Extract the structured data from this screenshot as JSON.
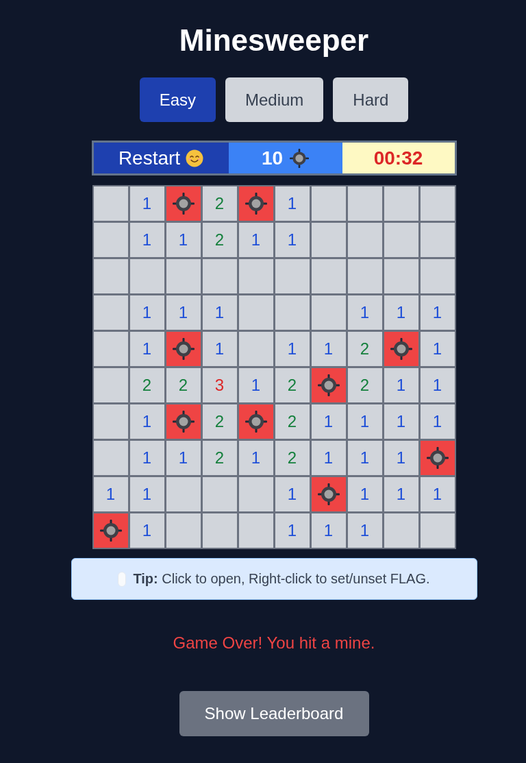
{
  "title": "Minesweeper",
  "difficulties": [
    {
      "label": "Easy",
      "selected": true
    },
    {
      "label": "Medium",
      "selected": false
    },
    {
      "label": "Hard",
      "selected": false
    }
  ],
  "status_bar": {
    "restart_label": "Restart",
    "mine_count": "10",
    "timer": "00:32"
  },
  "board": {
    "rows": [
      [
        {
          "kind": "empty"
        },
        {
          "kind": "number",
          "value": "1",
          "color": "#1d4ed8"
        },
        {
          "kind": "mine"
        },
        {
          "kind": "number",
          "value": "2",
          "color": "#15803d"
        },
        {
          "kind": "mine"
        },
        {
          "kind": "number",
          "value": "1",
          "color": "#1d4ed8"
        },
        {
          "kind": "empty"
        },
        {
          "kind": "empty"
        },
        {
          "kind": "empty"
        },
        {
          "kind": "empty"
        }
      ],
      [
        {
          "kind": "empty"
        },
        {
          "kind": "number",
          "value": "1",
          "color": "#1d4ed8"
        },
        {
          "kind": "number",
          "value": "1",
          "color": "#1d4ed8"
        },
        {
          "kind": "number",
          "value": "2",
          "color": "#15803d"
        },
        {
          "kind": "number",
          "value": "1",
          "color": "#1d4ed8"
        },
        {
          "kind": "number",
          "value": "1",
          "color": "#1d4ed8"
        },
        {
          "kind": "empty"
        },
        {
          "kind": "empty"
        },
        {
          "kind": "empty"
        },
        {
          "kind": "empty"
        }
      ],
      [
        {
          "kind": "empty"
        },
        {
          "kind": "empty"
        },
        {
          "kind": "empty"
        },
        {
          "kind": "empty"
        },
        {
          "kind": "empty"
        },
        {
          "kind": "empty"
        },
        {
          "kind": "empty"
        },
        {
          "kind": "empty"
        },
        {
          "kind": "empty"
        },
        {
          "kind": "empty"
        }
      ],
      [
        {
          "kind": "empty"
        },
        {
          "kind": "number",
          "value": "1",
          "color": "#1d4ed8"
        },
        {
          "kind": "number",
          "value": "1",
          "color": "#1d4ed8"
        },
        {
          "kind": "number",
          "value": "1",
          "color": "#1d4ed8"
        },
        {
          "kind": "empty"
        },
        {
          "kind": "empty"
        },
        {
          "kind": "empty"
        },
        {
          "kind": "number",
          "value": "1",
          "color": "#1d4ed8"
        },
        {
          "kind": "number",
          "value": "1",
          "color": "#1d4ed8"
        },
        {
          "kind": "number",
          "value": "1",
          "color": "#1d4ed8"
        }
      ],
      [
        {
          "kind": "empty"
        },
        {
          "kind": "number",
          "value": "1",
          "color": "#1d4ed8"
        },
        {
          "kind": "mine"
        },
        {
          "kind": "number",
          "value": "1",
          "color": "#1d4ed8"
        },
        {
          "kind": "empty"
        },
        {
          "kind": "number",
          "value": "1",
          "color": "#1d4ed8"
        },
        {
          "kind": "number",
          "value": "1",
          "color": "#1d4ed8"
        },
        {
          "kind": "number",
          "value": "2",
          "color": "#15803d"
        },
        {
          "kind": "mine"
        },
        {
          "kind": "number",
          "value": "1",
          "color": "#1d4ed8"
        }
      ],
      [
        {
          "kind": "empty"
        },
        {
          "kind": "number",
          "value": "2",
          "color": "#15803d"
        },
        {
          "kind": "number",
          "value": "2",
          "color": "#15803d"
        },
        {
          "kind": "number",
          "value": "3",
          "color": "#dc2626"
        },
        {
          "kind": "number",
          "value": "1",
          "color": "#1d4ed8"
        },
        {
          "kind": "number",
          "value": "2",
          "color": "#15803d"
        },
        {
          "kind": "mine"
        },
        {
          "kind": "number",
          "value": "2",
          "color": "#15803d"
        },
        {
          "kind": "number",
          "value": "1",
          "color": "#1d4ed8"
        },
        {
          "kind": "number",
          "value": "1",
          "color": "#1d4ed8"
        }
      ],
      [
        {
          "kind": "empty"
        },
        {
          "kind": "number",
          "value": "1",
          "color": "#1d4ed8"
        },
        {
          "kind": "mine"
        },
        {
          "kind": "number",
          "value": "2",
          "color": "#15803d"
        },
        {
          "kind": "mine"
        },
        {
          "kind": "number",
          "value": "2",
          "color": "#15803d"
        },
        {
          "kind": "number",
          "value": "1",
          "color": "#1d4ed8"
        },
        {
          "kind": "number",
          "value": "1",
          "color": "#1d4ed8"
        },
        {
          "kind": "number",
          "value": "1",
          "color": "#1d4ed8"
        },
        {
          "kind": "number",
          "value": "1",
          "color": "#1d4ed8"
        }
      ],
      [
        {
          "kind": "empty"
        },
        {
          "kind": "number",
          "value": "1",
          "color": "#1d4ed8"
        },
        {
          "kind": "number",
          "value": "1",
          "color": "#1d4ed8"
        },
        {
          "kind": "number",
          "value": "2",
          "color": "#15803d"
        },
        {
          "kind": "number",
          "value": "1",
          "color": "#1d4ed8"
        },
        {
          "kind": "number",
          "value": "2",
          "color": "#15803d"
        },
        {
          "kind": "number",
          "value": "1",
          "color": "#1d4ed8"
        },
        {
          "kind": "number",
          "value": "1",
          "color": "#1d4ed8"
        },
        {
          "kind": "number",
          "value": "1",
          "color": "#1d4ed8"
        },
        {
          "kind": "mine"
        }
      ],
      [
        {
          "kind": "number",
          "value": "1",
          "color": "#1d4ed8"
        },
        {
          "kind": "number",
          "value": "1",
          "color": "#1d4ed8"
        },
        {
          "kind": "empty"
        },
        {
          "kind": "empty"
        },
        {
          "kind": "empty"
        },
        {
          "kind": "number",
          "value": "1",
          "color": "#1d4ed8"
        },
        {
          "kind": "mine"
        },
        {
          "kind": "number",
          "value": "1",
          "color": "#1d4ed8"
        },
        {
          "kind": "number",
          "value": "1",
          "color": "#1d4ed8"
        },
        {
          "kind": "number",
          "value": "1",
          "color": "#1d4ed8"
        }
      ],
      [
        {
          "kind": "mine"
        },
        {
          "kind": "number",
          "value": "1",
          "color": "#1d4ed8"
        },
        {
          "kind": "empty"
        },
        {
          "kind": "empty"
        },
        {
          "kind": "empty"
        },
        {
          "kind": "number",
          "value": "1",
          "color": "#1d4ed8"
        },
        {
          "kind": "number",
          "value": "1",
          "color": "#1d4ed8"
        },
        {
          "kind": "number",
          "value": "1",
          "color": "#1d4ed8"
        },
        {
          "kind": "empty"
        },
        {
          "kind": "empty"
        }
      ]
    ]
  },
  "tip": "**Tip:** Click to open, Right-click to set/unset FLAG.",
  "message": "Game Over! You hit a mine.",
  "leaderboard_button": "Show Leaderboard"
}
